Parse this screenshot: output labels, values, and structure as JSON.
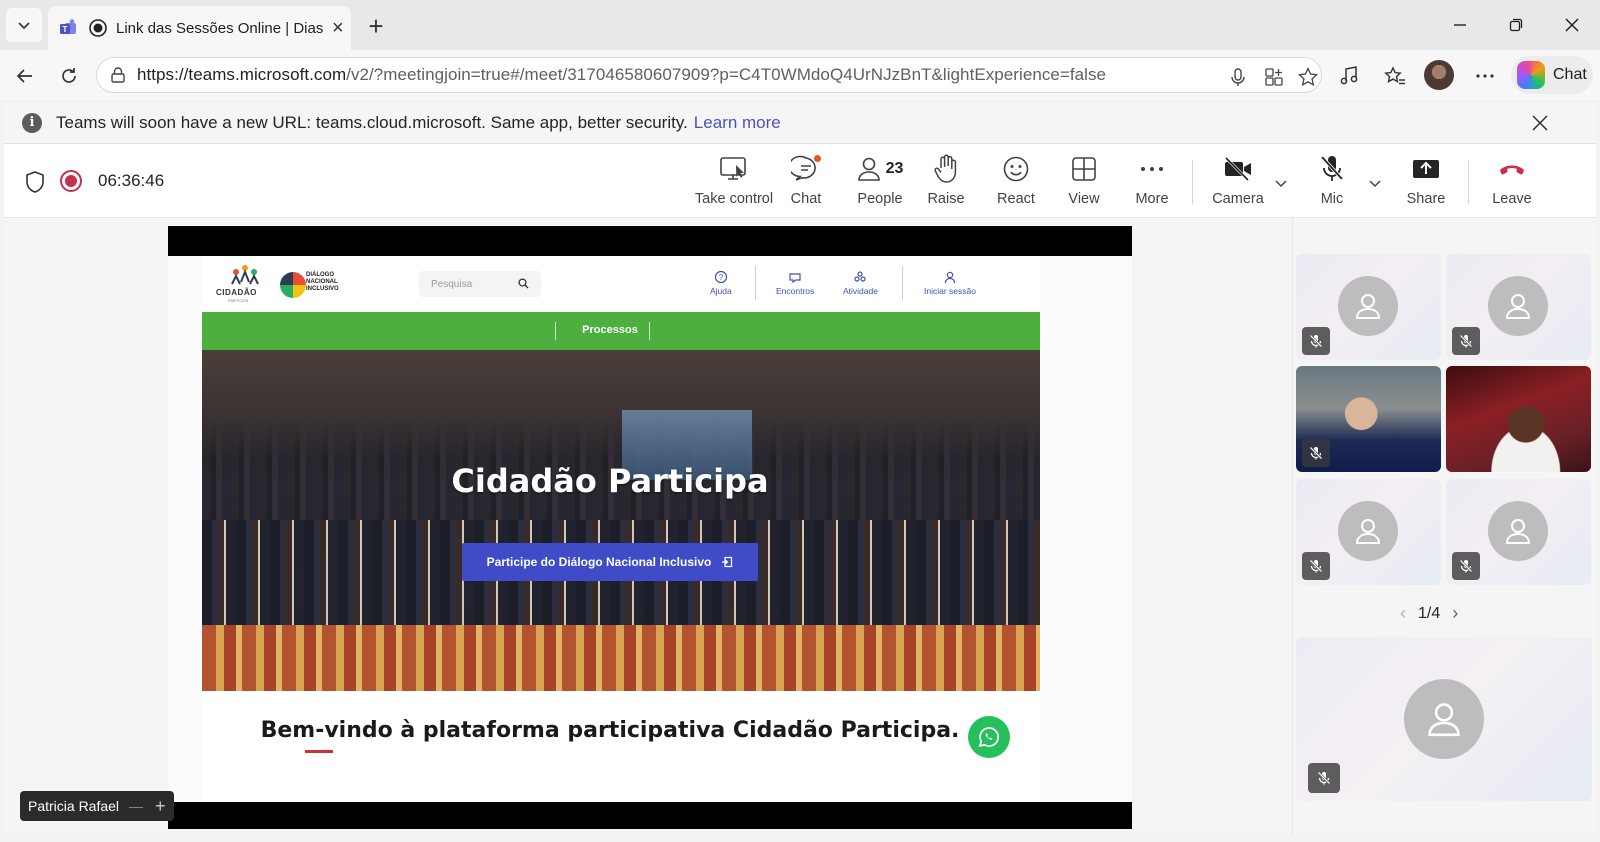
{
  "browser": {
    "tab_title": "Link das Sessões Online | Dias",
    "url_host": "https://teams.microsoft.com",
    "url_rest": "/v2/?meetingjoin=true#/meet/317046580607909?p=C4T0WMdoQ4UrNJzBnT&lightExperience=false",
    "copilot_label": "Chat"
  },
  "infobar": {
    "message": "Teams will soon have a new URL: teams.cloud.microsoft. Same app, better security.",
    "link": "Learn more",
    "info_glyph": "i"
  },
  "meeting": {
    "timer": "06:36:46",
    "people_count": "23",
    "controls": {
      "take_control": "Take control",
      "chat": "Chat",
      "people": "People",
      "raise": "Raise",
      "react": "React",
      "view": "View",
      "more": "More",
      "camera": "Camera",
      "mic": "Mic",
      "share": "Share",
      "leave": "Leave"
    },
    "colors": {
      "record": "#c4314b",
      "leave": "#c4314b",
      "accent": "#4f52b2"
    }
  },
  "shared_site": {
    "logo_text": "CIDADÃO",
    "logo_sub": "PARTICIPA",
    "logo2_text": "DIÁLOGO NACIONAL INCLUSIVO",
    "search_placeholder": "Pesquisa",
    "nav": [
      {
        "label": "Ajuda"
      },
      {
        "label": "Encontros"
      },
      {
        "label": "Atividade"
      },
      {
        "label": "Iniciar sessão"
      }
    ],
    "green_nav": "Processos",
    "hero_title": "Cidadão Participa",
    "hero_button": "Participe do Diálogo Nacional Inclusivo",
    "welcome": "Bem-vindo à plataforma participativa Cidadão Participa.",
    "colors": {
      "green": "#4caf3e",
      "button": "#3f4bc7",
      "whatsapp": "#25c05b"
    }
  },
  "presenter": {
    "name": "Patricia Rafael"
  },
  "gallery": {
    "page": "1/4",
    "tiles": [
      {
        "type": "avatar",
        "muted": true
      },
      {
        "type": "avatar",
        "muted": true
      },
      {
        "type": "video",
        "muted": true
      },
      {
        "type": "video",
        "muted": false
      },
      {
        "type": "avatar",
        "muted": true
      },
      {
        "type": "avatar",
        "muted": true
      }
    ]
  }
}
